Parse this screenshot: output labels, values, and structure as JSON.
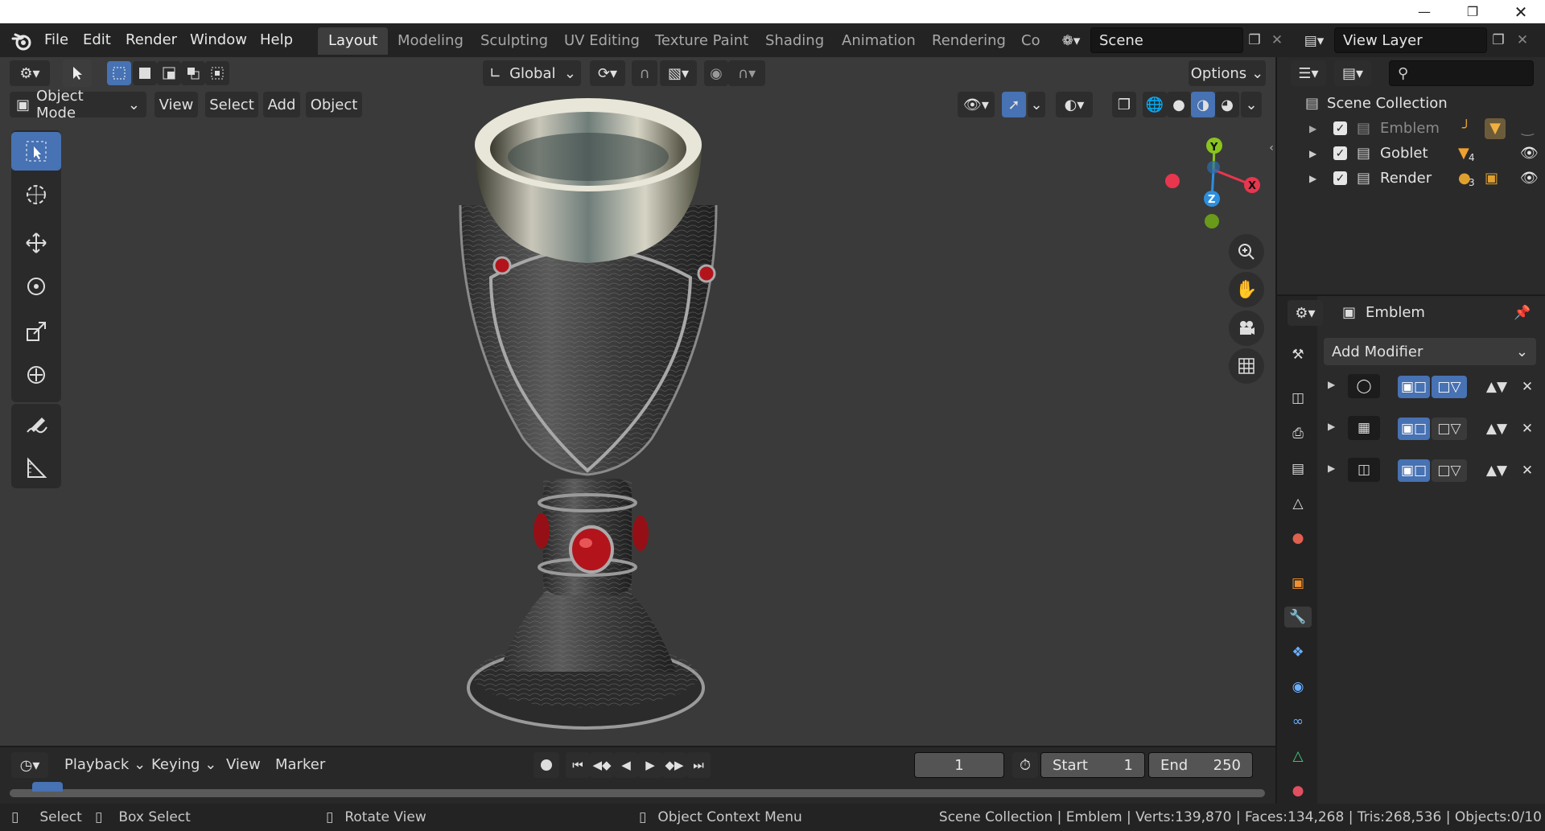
{
  "menus": [
    "File",
    "Edit",
    "Render",
    "Window",
    "Help"
  ],
  "workspaces": [
    "Layout",
    "Modeling",
    "Sculpting",
    "UV Editing",
    "Texture Paint",
    "Shading",
    "Animation",
    "Rendering",
    "Co"
  ],
  "scene_field": "Scene",
  "view_layer_field": "View Layer",
  "orientation": "Global",
  "options_label": "Options",
  "viewport_header": {
    "mode": "Object Mode",
    "view": "View",
    "select": "Select",
    "add": "Add",
    "object": "Object"
  },
  "gizmo": {
    "x": "X",
    "y": "Y",
    "z": "Z"
  },
  "outliner": {
    "root": "Scene Collection",
    "items": [
      {
        "name": "Emblem",
        "dimmed": true
      },
      {
        "name": "Goblet",
        "dimmed": false,
        "badge": "4"
      },
      {
        "name": "Render",
        "dimmed": false,
        "badge": "3"
      }
    ]
  },
  "properties": {
    "object_name": "Emblem",
    "add_modifier": "Add Modifier",
    "modifiers": [
      "subdivision",
      "lattice",
      "array"
    ]
  },
  "timeline": {
    "playback": "Playback",
    "keying": "Keying",
    "view": "View",
    "marker": "Marker",
    "current_frame": "1",
    "start_label": "Start",
    "start_value": "1",
    "end_label": "End",
    "end_value": "250"
  },
  "statusbar": {
    "select": "Select",
    "box_select": "Box Select",
    "rotate_view": "Rotate View",
    "context_menu": "Object Context Menu",
    "stats": "Scene Collection | Emblem | Verts:139,870 | Faces:134,268 | Tris:268,536 | Objects:0/10"
  },
  "colors": {
    "accent": "#4772b3",
    "axis_x": "#e8364e",
    "axis_y": "#8ac41e",
    "axis_z": "#2c8fdf",
    "gem": "#b3141c"
  }
}
